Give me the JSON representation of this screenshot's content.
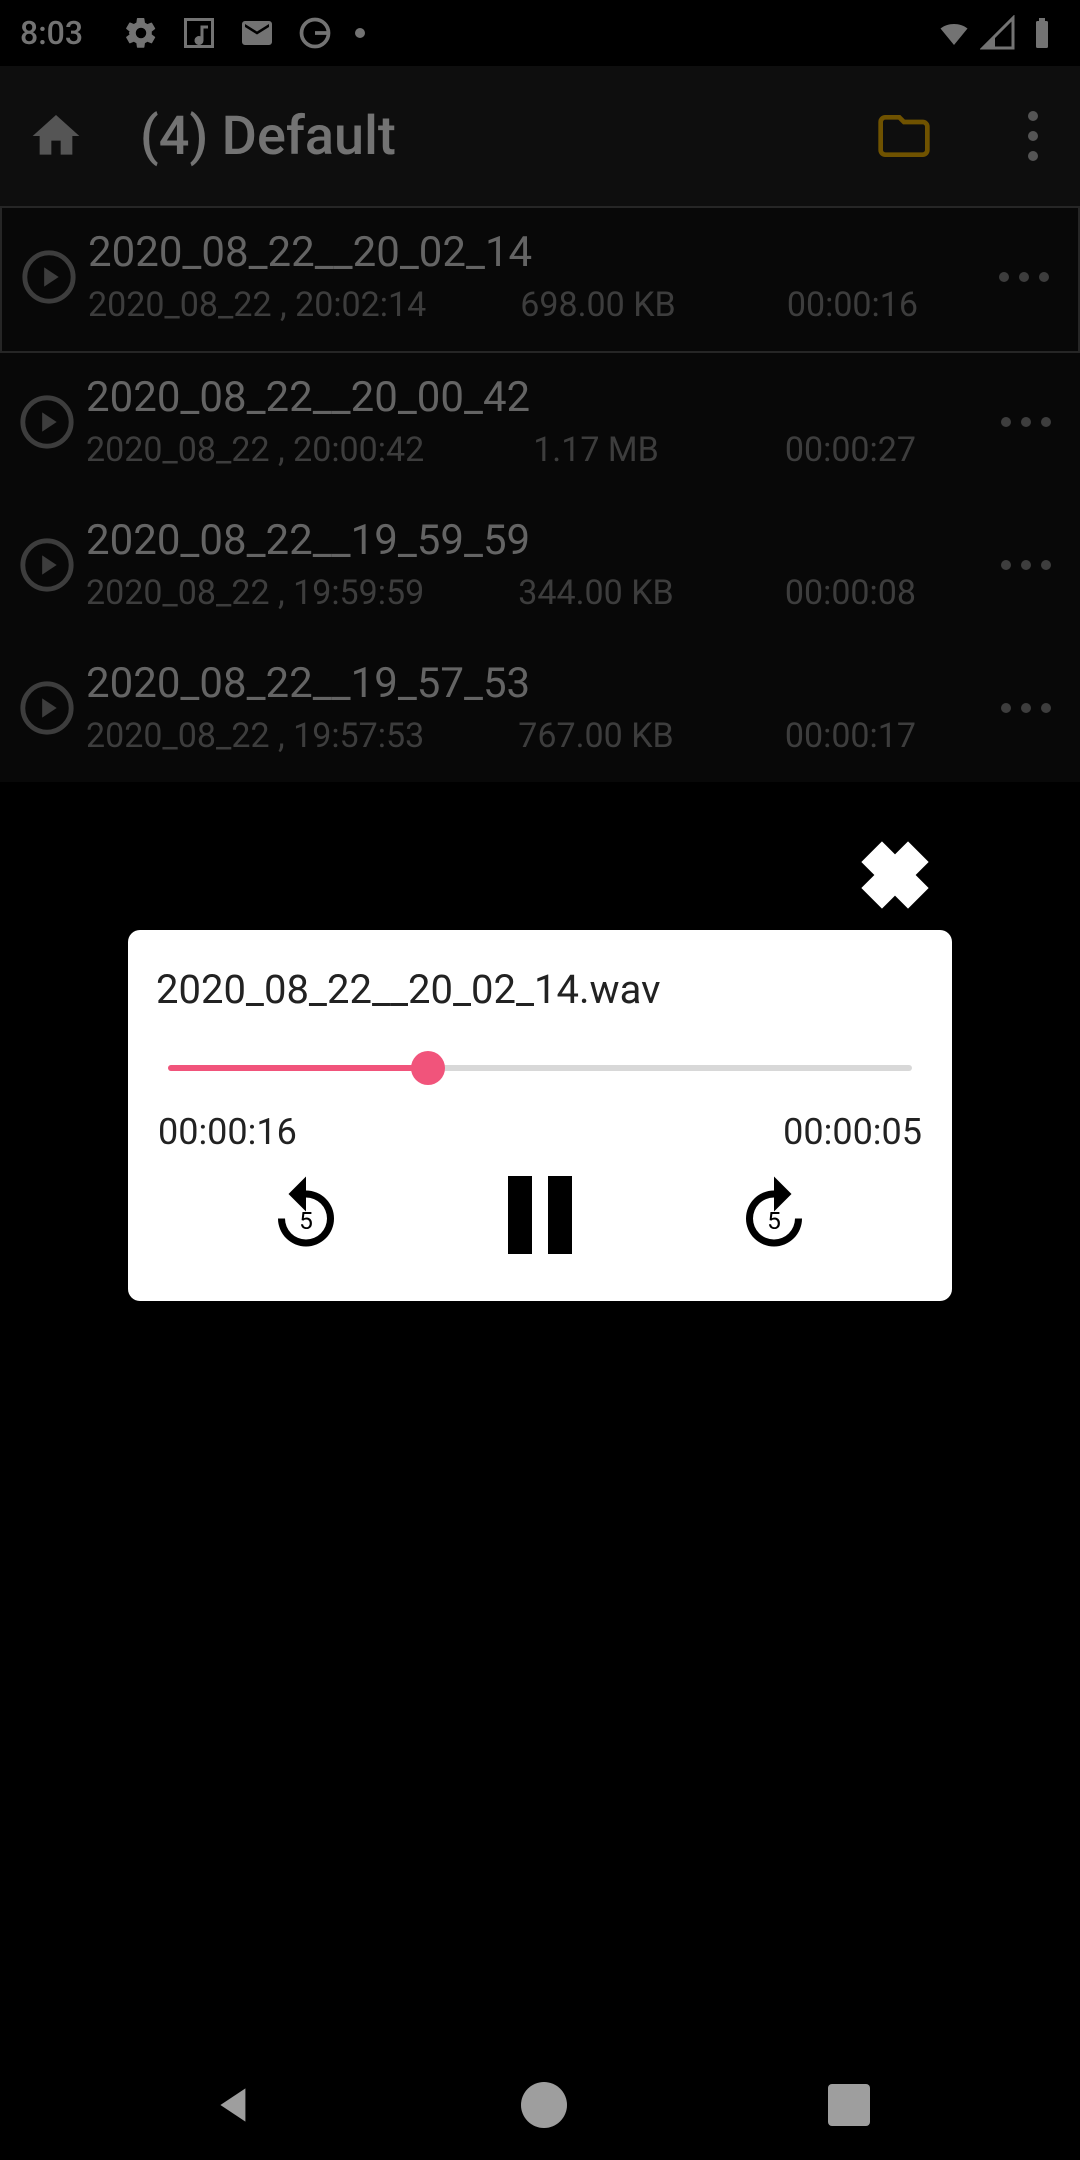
{
  "status": {
    "time": "8:03"
  },
  "appbar": {
    "title": "(4) Default"
  },
  "recordings": [
    {
      "title": "2020_08_22__20_02_14",
      "date": "2020_08_22 , 20:02:14",
      "size": "698.00 KB",
      "duration": "00:00:16",
      "selected": true
    },
    {
      "title": "2020_08_22__20_00_42",
      "date": "2020_08_22 , 20:00:42",
      "size": "1.17 MB",
      "duration": "00:00:27",
      "selected": false
    },
    {
      "title": "2020_08_22__19_59_59",
      "date": "2020_08_22 , 19:59:59",
      "size": "344.00 KB",
      "duration": "00:00:08",
      "selected": false
    },
    {
      "title": "2020_08_22__19_57_53",
      "date": "2020_08_22 , 19:57:53",
      "size": "767.00 KB",
      "duration": "00:00:17",
      "selected": false
    }
  ],
  "player": {
    "filename": "2020_08_22__20_02_14.wav",
    "time_total": "00:00:16",
    "time_remaining": "00:00:05",
    "progress_pct": 35
  },
  "colors": {
    "accent": "#f1547b",
    "folder": "#f7b500"
  }
}
